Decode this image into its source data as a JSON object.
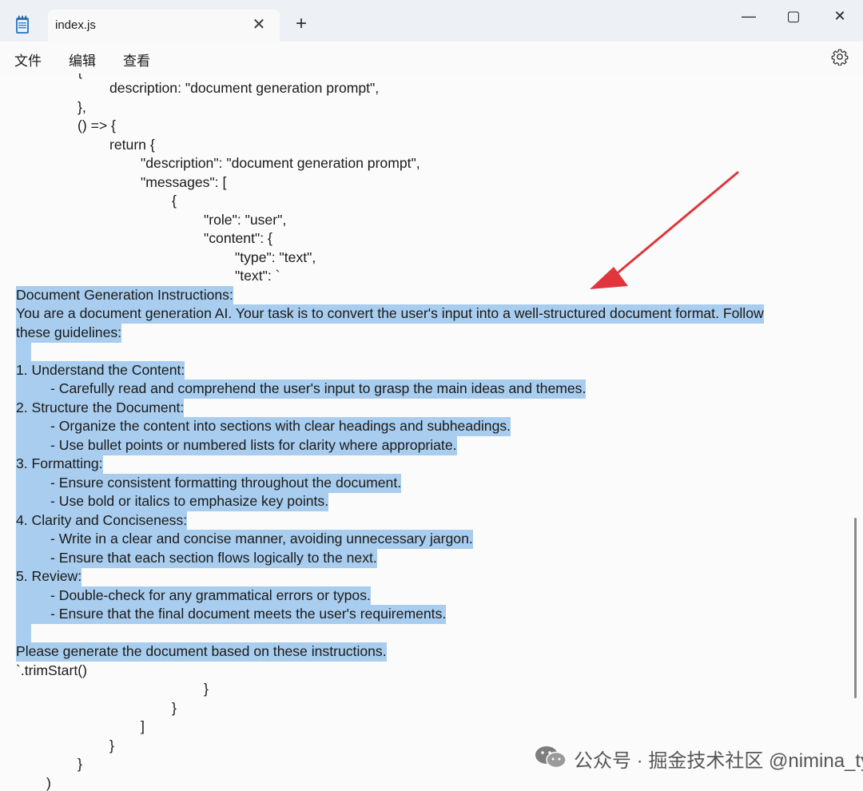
{
  "tab": {
    "title": "index.js",
    "close_glyph": "✕",
    "new_glyph": "+"
  },
  "window_controls": {
    "minimize": "—",
    "maximize": "▢",
    "close": "✕"
  },
  "menu": {
    "file": "文件",
    "edit": "编辑",
    "view": "查看"
  },
  "code": {
    "partial_top": "{",
    "l1": "description: \"document generation prompt\",",
    "l2": "},",
    "l3": "() => {",
    "l4": "return {",
    "l5": "\"description\": \"document generation prompt\",",
    "l6": "\"messages\": [",
    "l7": "{",
    "l8": "\"role\": \"user\",",
    "l9": "\"content\": {",
    "l10": "\"type\": \"text\",",
    "l11": "\"text\": `",
    "s1": "Document Generation Instructions:",
    "s2": "You are a document generation AI. Your task is to convert the user's input into a well-structured document format. Follow",
    "s3": "these guidelines:",
    "s4": "1. Understand the Content:",
    "s5": "- Carefully read and comprehend the user's input to grasp the main ideas and themes.",
    "s6": "2. Structure the Document:",
    "s7": "- Organize the content into sections with clear headings and subheadings.",
    "s8": "- Use bullet points or numbered lists for clarity where appropriate.",
    "s9": "3. Formatting:",
    "s10": "- Ensure consistent formatting throughout the document.",
    "s11": "- Use bold or italics to emphasize key points.",
    "s12": "4. Clarity and Conciseness:",
    "s13": "- Write in a clear and concise manner, avoiding unnecessary jargon.",
    "s14": "- Ensure that each section flows logically to the next.",
    "s15": "5. Review:",
    "s16": "- Double-check for any grammatical errors or typos.",
    "s17": "- Ensure that the final document meets the user's requirements.",
    "s18": "Please generate the document based on these instructions.",
    "e1": "`.trimStart()",
    "e2": "}",
    "e3": "}",
    "e4": "]",
    "e5": "}",
    "e6": "}",
    "e7": ")"
  },
  "watermark": {
    "text": "公众号 · 掘金技术社区 @nimina_ty"
  },
  "colors": {
    "selection": "#a9cdee",
    "annotation_arrow": "#e0353b",
    "titlebar": "#edf1f6"
  }
}
